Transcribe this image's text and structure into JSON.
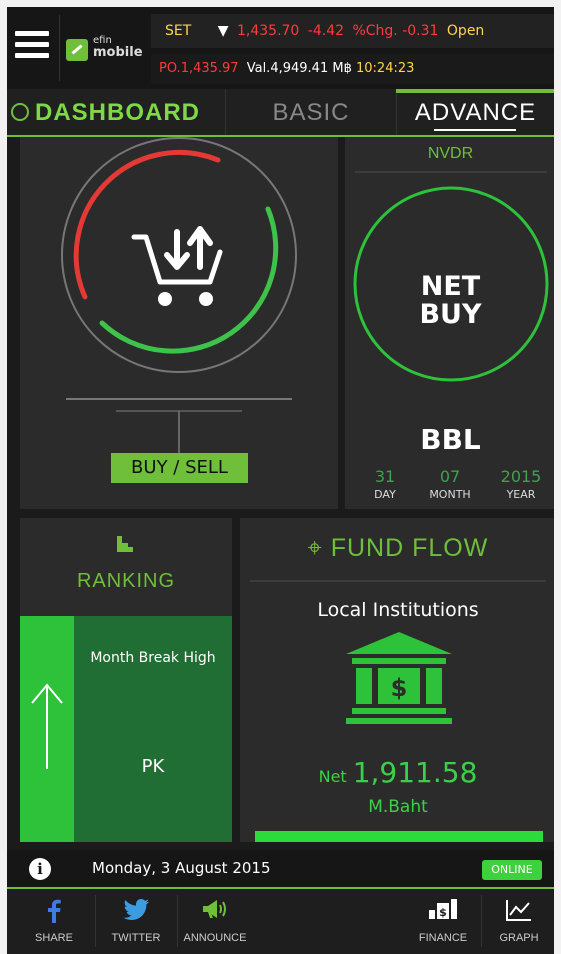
{
  "ticker": {
    "index": "SET",
    "arrow": "▼",
    "price": "1,435.70",
    "change": "-4.42",
    "pct_label": "%Chg.",
    "pct": "-0.31",
    "open_label": "Open",
    "row2_prefix": "PO.",
    "row2_price": "1,435.97",
    "val_label": "Val.",
    "val": "4,949.41",
    "unit": "M฿",
    "time": "10:24:23"
  },
  "logo": {
    "line1": "efin",
    "line2": "mobile"
  },
  "tabs": {
    "dashboard": "DASHBOARD",
    "basic": "BASIC",
    "advance": "ADVANCE"
  },
  "buysell": {
    "button": "BUY / SELL"
  },
  "nvdr": {
    "label": "NVDR",
    "status_line1": "NET",
    "status_line2": "BUY",
    "symbol": "BBL",
    "day": "31",
    "day_label": "DAY",
    "month": "07",
    "month_label": "MONTH",
    "year": "2015",
    "year_label": "YEAR"
  },
  "ranking": {
    "title": "RANKING",
    "description": "Month Break High",
    "symbol": "PK"
  },
  "fund_flow": {
    "title": "FUND FLOW",
    "subtitle": "Local Institutions",
    "net_label": "Net",
    "net_value": "1,911.58",
    "unit": "M.Baht"
  },
  "status": {
    "date": "Monday, 3 August 2015",
    "connection": "ONLINE"
  },
  "bottom_nav": {
    "share": "SHARE",
    "twitter": "TWITTER",
    "announce": "ANNOUNCE",
    "finance": "FINANCE",
    "graph": "GRAPH"
  },
  "colors": {
    "accent": "#6fbf3a",
    "up": "#2ec13a",
    "down": "#ff3b3b",
    "panel": "#2b2b2b"
  }
}
